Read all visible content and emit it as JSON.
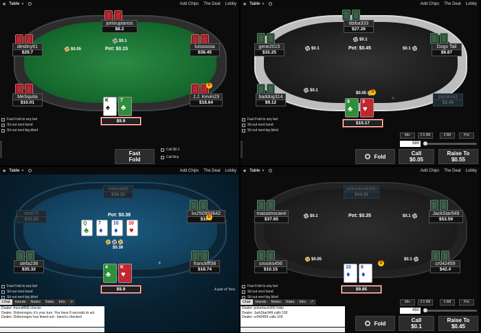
{
  "topbar": {
    "table": "Table",
    "add_chips": "Add Chips",
    "the_deal": "The Deal",
    "lobby": "Lobby"
  },
  "t1": {
    "seats": [
      {
        "name": "jontxupianos",
        "stack": "$8.2"
      },
      {
        "name": "destiny61",
        "stack": "$29.7"
      },
      {
        "name": "luissoosa",
        "stack": "$38.45"
      },
      {
        "name": "MeSquita",
        "stack": "$10.01"
      },
      {
        "name": "J.J. Kevin23",
        "stack": "$18.64"
      }
    ],
    "bets": {
      "top": "$0.1",
      "left": "$0.05"
    },
    "pot": "Pot: $0.15",
    "hero": {
      "stack": "$9.9",
      "c1": "K",
      "c2": "7"
    },
    "options": [
      "Fast Fold to any bet",
      "Sit out next hand",
      "Sit out next big blind"
    ],
    "fast_fold": "Fast\nFold",
    "fast_fold_1": "Fast",
    "fast_fold_2": "Fold",
    "call_opt": "Call $0.1",
    "call_any": "Call Any"
  },
  "t2": {
    "seats": [
      {
        "name": "tibiba333",
        "stack": "$27.26"
      },
      {
        "name": "gene2015",
        "stack": "$32.25"
      },
      {
        "name": "Dogs Tail",
        "stack": "$8.87"
      },
      {
        "name": "baddog314",
        "stack": "$9.12"
      },
      {
        "name": "patries41",
        "stack": "$2.49"
      }
    ],
    "bets": {
      "top": "$0.1",
      "left": "$0.1",
      "right": "$0.1",
      "midleft": "$0.1",
      "center": "$0.05"
    },
    "pot": "Pot: $0.45",
    "hero": {
      "stack": "$10.17",
      "c1": "9",
      "c2": "3"
    },
    "options": [
      "Fast Fold to any bet",
      "Sit out next hand",
      "Sit out next big blind"
    ],
    "sizes": [
      "Min",
      "2.5 BB",
      "3 BB",
      "Pot"
    ],
    "bet_value": "580",
    "fold": "Fold",
    "call": "Call",
    "call_amt": "$0.05",
    "raise": "Raise To",
    "raise_amt": "$0.55"
  },
  "t3": {
    "seats": [
      {
        "name": "mbenda5",
        "stack": "$38.32"
      },
      {
        "name": "rex675",
        "stack": "$15.02"
      },
      {
        "name": "kx250993642",
        "stack": "$10.4"
      },
      {
        "name": "stefa236",
        "stack": "$35.32"
      },
      {
        "name": "franckfff38",
        "stack": "$18.74"
      }
    ],
    "pot": "Pot: $0.38",
    "pot_chips": "$0.38",
    "board": [
      "Q",
      "7",
      "10",
      "10"
    ],
    "hero": {
      "stack": "$9.9",
      "c1": "4",
      "c2": "K"
    },
    "options": [
      "Fast Fold to any bet",
      "Sit out next hand",
      "Sit out next big blind"
    ],
    "hand_label": "A pair of Tens",
    "chat_tabs": [
      "Chat",
      "Hands",
      "Notes",
      "Stats",
      "Info"
    ],
    "chat_lines": [
      "Dealer: franckfff38 checks",
      "Dealer: Dobronogov, it's your turn. You have 8 seconds to act",
      "Dealer: Dobronogov has timed out - hand is checked"
    ]
  },
  "t4": {
    "seats": [
      {
        "name": "pokerbuck300",
        "stack": "$44.33"
      },
      {
        "name": "massimocane",
        "stack": "$37.65"
      },
      {
        "name": "JackStar949",
        "stack": "$53.59"
      },
      {
        "name": "snooks456",
        "stack": "$10.15"
      },
      {
        "name": "cr042459",
        "stack": "$42.4"
      }
    ],
    "bets": {
      "left": "$0.1",
      "right": "$0.1",
      "midleft": "$0.05",
      "midright": "$0.1"
    },
    "pot": "Pot: $0.35",
    "hero": {
      "stack": "$9.85",
      "c1": "10",
      "c2": "8"
    },
    "options": [
      "Fast Fold to any bet",
      "Sit out next hand",
      "Sit out next big blind"
    ],
    "sizes": [
      "Min",
      "2.5 BB",
      "3 BB",
      "Pot"
    ],
    "bet_value": "450",
    "chat_tabs": [
      "Chat",
      "Hands",
      "Notes",
      "Stats",
      "Info"
    ],
    "chat_lines": [
      "Dealer: pokerbuck300 folds",
      "Dealer: JackStar949 calls 100",
      "Dealer: cr042459 calls 100"
    ],
    "fold": "Fold",
    "call": "Call",
    "call_amt": "$0.1",
    "raise": "Raise To",
    "raise_amt": "$0.45"
  }
}
